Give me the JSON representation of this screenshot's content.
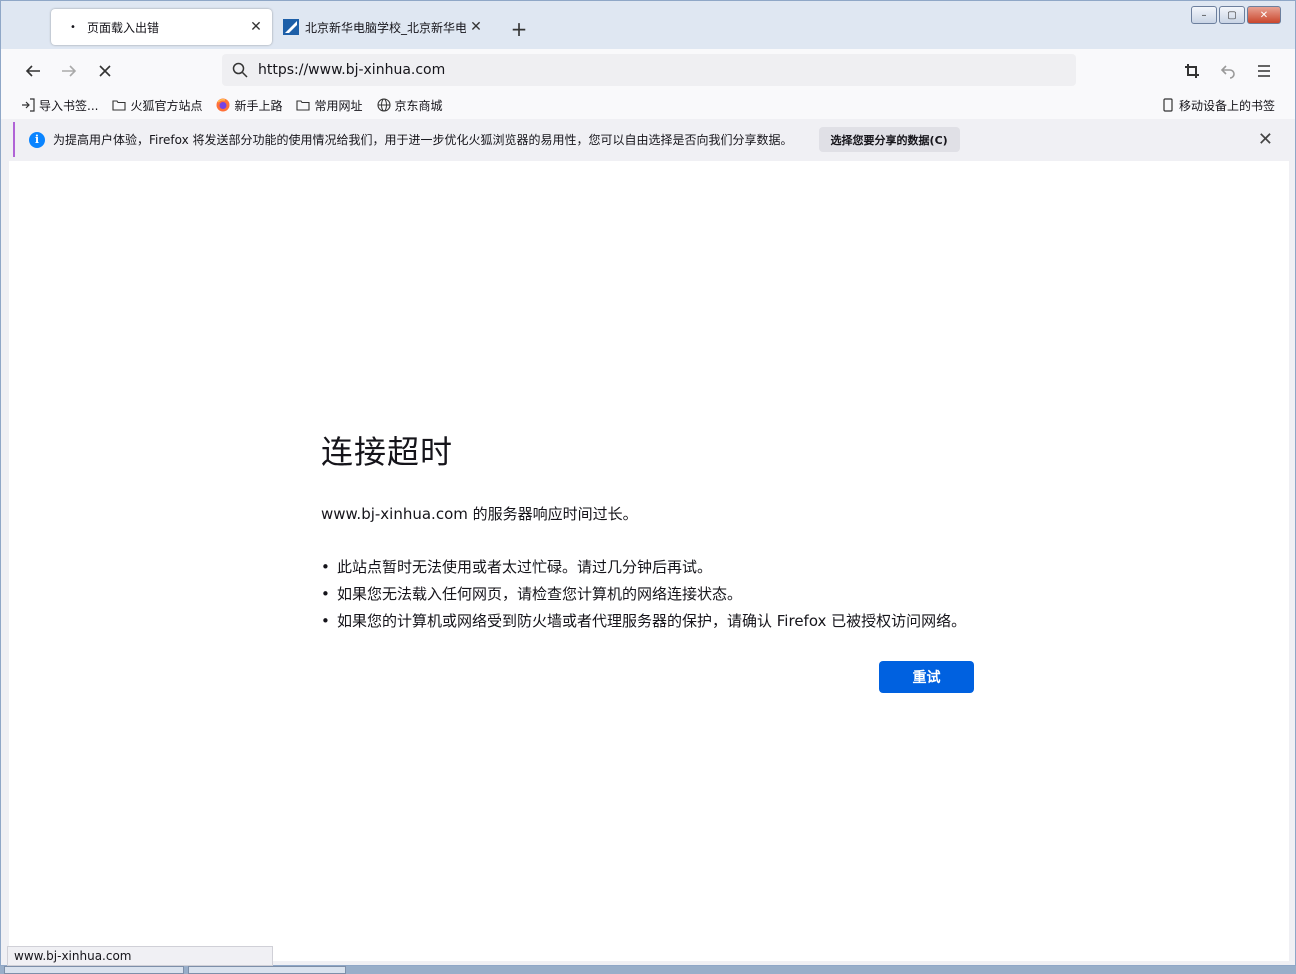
{
  "tabs": [
    {
      "label": "页面载入出错",
      "favicon": "•",
      "active": true
    },
    {
      "label": "北京新华电脑学校_北京新华电脑",
      "active": false
    }
  ],
  "window_controls": {
    "min": "–",
    "max": "▢",
    "close": "✕"
  },
  "nav": {
    "url": "https://www.bj-xinhua.com"
  },
  "bookmarks": {
    "items": [
      {
        "label": "导入书签...",
        "icon": "import-icon"
      },
      {
        "label": "火狐官方站点",
        "icon": "folder-icon"
      },
      {
        "label": "新手上路",
        "icon": "firefox-icon"
      },
      {
        "label": "常用网址",
        "icon": "folder-icon"
      },
      {
        "label": "京东商城",
        "icon": "globe-icon"
      }
    ],
    "mobile": "移动设备上的书签"
  },
  "notification": {
    "text": "为提高用户体验，Firefox 将发送部分功能的使用情况给我们，用于进一步优化火狐浏览器的易用性，您可以自由选择是否向我们分享数据。",
    "button": "选择您要分享的数据(C)"
  },
  "error": {
    "title": "连接超时",
    "message": "www.bj-xinhua.com 的服务器响应时间过长。",
    "tips": [
      "此站点暂时无法使用或者太过忙碌。请过几分钟后再试。",
      "如果您无法载入任何网页，请检查您计算机的网络连接状态。",
      "如果您的计算机或网络受到防火墙或者代理服务器的保护，请确认 Firefox 已被授权访问网络。"
    ],
    "retry": "重试"
  },
  "status": "www.bj-xinhua.com"
}
